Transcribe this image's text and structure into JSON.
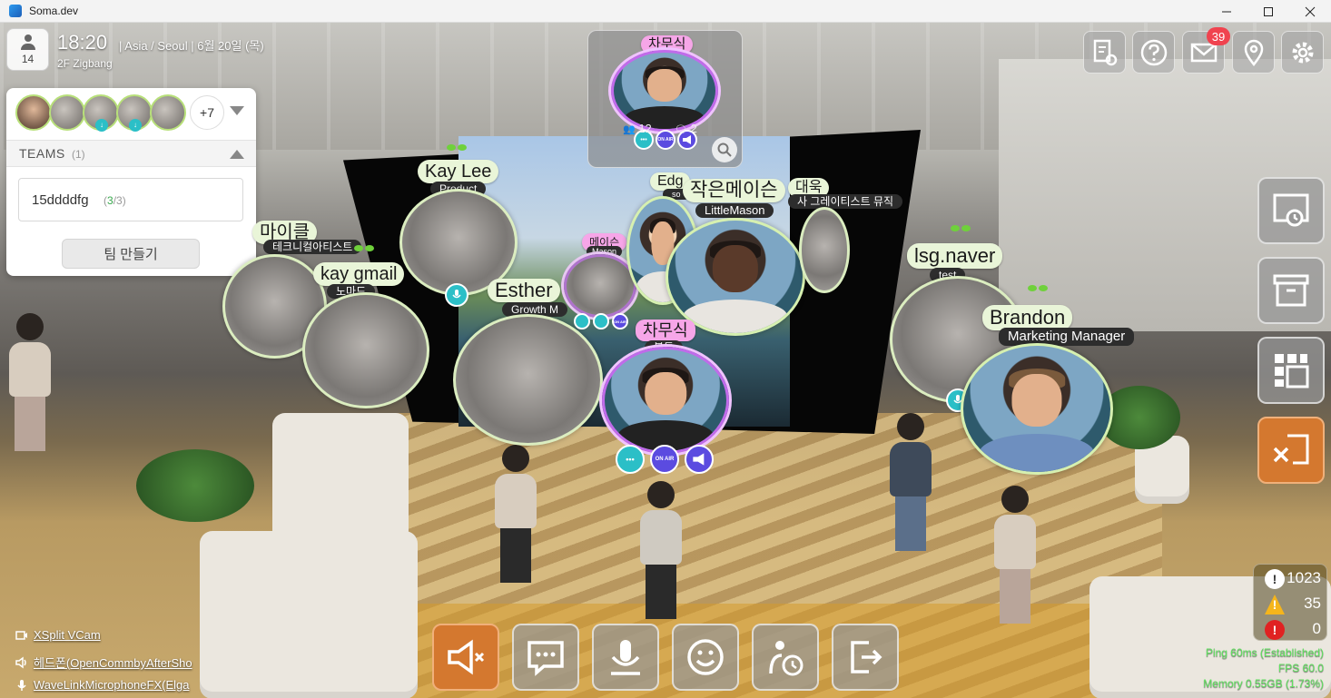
{
  "window": {
    "title": "Soma.dev"
  },
  "header": {
    "user_count": "14",
    "time": "18:20",
    "tz_date": "| Asia / Seoul  |  6월 20일 (목)",
    "floor": "2F Zigbang"
  },
  "panel": {
    "more_count": "+7",
    "teams_label": "TEAMS",
    "teams_count": "(1)",
    "team": {
      "name": "15ddddfg",
      "members_open": "(",
      "members_active": "3",
      "members_rest": "/3)"
    },
    "create_team_label": "팀 만들기"
  },
  "toolbar_right": {
    "mail_badge": "39"
  },
  "spotlight": {
    "name": "차무식",
    "role": "볼튼",
    "viewers": "12",
    "comments": "2"
  },
  "participants": [
    {
      "name": "Kay Lee",
      "role": "Product"
    },
    {
      "name": "마이클",
      "role": "테크니컬아티스트"
    },
    {
      "name": "kay gmail",
      "role": "노마드"
    },
    {
      "name": "Esther",
      "role": "Growth M"
    },
    {
      "name": "메이슨",
      "role": "Mason"
    },
    {
      "name": "Edg",
      "role": "so"
    },
    {
      "name": "작은메이슨",
      "role": "LittleMason"
    },
    {
      "name": "대욱",
      "role": "사 그레이티스트 뮤직"
    },
    {
      "name": "차무식",
      "role": "볼튼"
    },
    {
      "name": "lsg.naver",
      "role": "test"
    },
    {
      "name": "Brandon",
      "role": "Marketing Manager"
    }
  ],
  "controls": {
    "on_air": "ON AIR",
    "dots": "•••"
  },
  "devices": [
    {
      "label": "XSplit VCam",
      "icon": "camera-icon"
    },
    {
      "label": "헤드폰(OpenCommbyAfterSho",
      "icon": "speaker-icon"
    },
    {
      "label": "WaveLinkMicrophoneFX(Elga",
      "icon": "microphone-icon"
    }
  ],
  "stats": {
    "info": "1023",
    "warning": "35",
    "error": "0"
  },
  "network": {
    "ping": "Ping 60ms (Established)",
    "fps": "FPS 60.0",
    "memory": "Memory 0.55GB (1.73%)"
  },
  "colors": {
    "accent_orange": "#d4782f",
    "teal": "#2bbfc7",
    "purple": "#5b4be0",
    "badge_red": "#f0434f",
    "tag_green": "#e9f5d8",
    "tag_pink": "#f6a6e8"
  }
}
